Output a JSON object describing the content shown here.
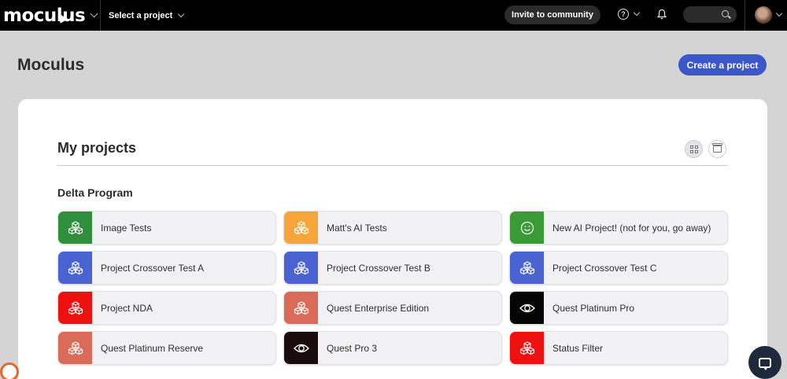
{
  "topbar": {
    "logo": "moculus",
    "project_select": "Select a project",
    "invite": "Invite to community",
    "help_glyph": "?"
  },
  "header": {
    "title": "Moculus",
    "create_button": "Create a project"
  },
  "panel": {
    "title": "My projects",
    "group_title": "Delta Program",
    "projects": [
      {
        "label": "Image Tests",
        "color": "#2f8f3c",
        "icon": "cubes-icon"
      },
      {
        "label": "Matt's AI Tests",
        "color": "#f7a53a",
        "icon": "cubes-icon"
      },
      {
        "label": "New AI Project! (not for you, go away)",
        "color": "#3a9a36",
        "icon": "smiley-icon"
      },
      {
        "label": "Project Crossover Test A",
        "color": "#4a63d0",
        "icon": "cubes-icon"
      },
      {
        "label": "Project Crossover Test B",
        "color": "#4a63d0",
        "icon": "cubes-icon"
      },
      {
        "label": "Project Crossover Test C",
        "color": "#4a63d0",
        "icon": "cubes-icon"
      },
      {
        "label": "Project NDA",
        "color": "#ef1010",
        "icon": "cubes-icon"
      },
      {
        "label": "Quest Enterprise Edition",
        "color": "#d96b58",
        "icon": "cubes-icon"
      },
      {
        "label": "Quest Platinum Pro",
        "color": "#050505",
        "icon": "eye-icon"
      },
      {
        "label": "Quest Platinum Reserve",
        "color": "#d96b58",
        "icon": "cubes-icon"
      },
      {
        "label": "Quest Pro 3",
        "color": "#1a0c0c",
        "icon": "eye-icon"
      },
      {
        "label": "Status Filter",
        "color": "#ef1010",
        "icon": "cubes-icon"
      }
    ]
  }
}
